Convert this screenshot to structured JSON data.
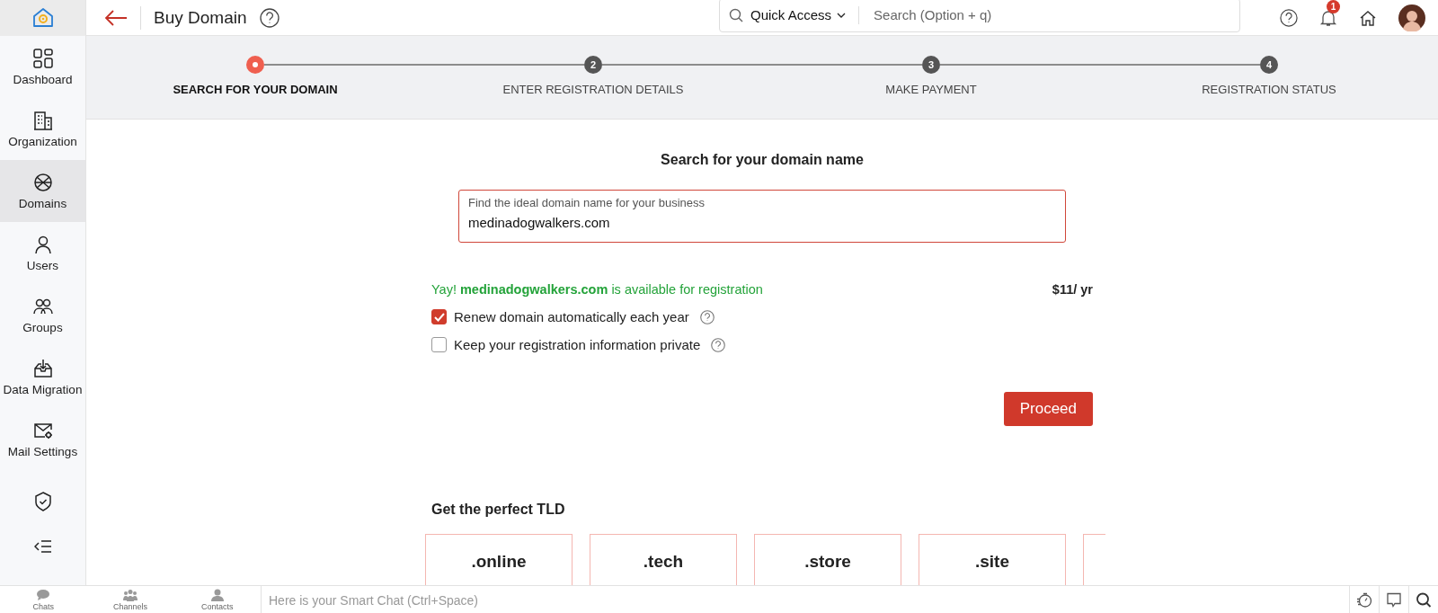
{
  "header": {
    "title": "Buy Domain",
    "quick_access": "Quick Access",
    "search": {
      "placeholder": "Search (Option + q)"
    },
    "notifications": "1"
  },
  "sidebar": {
    "items": [
      {
        "kind": "dashboard",
        "label": "Dashboard",
        "selected": false
      },
      {
        "kind": "organization",
        "label": "Organization",
        "selected": false
      },
      {
        "kind": "domains",
        "label": "Domains",
        "selected": true
      },
      {
        "kind": "users",
        "label": "Users",
        "selected": false
      },
      {
        "kind": "groups",
        "label": "Groups",
        "selected": false
      },
      {
        "kind": "migration",
        "label": "Data Migration",
        "selected": false
      },
      {
        "kind": "mail",
        "label": "Mail Settings",
        "selected": false
      },
      {
        "kind": "security",
        "selected": false
      }
    ]
  },
  "steps": [
    {
      "label": "SEARCH FOR YOUR DOMAIN",
      "selected": true
    },
    {
      "number": "2",
      "label": "ENTER REGISTRATION DETAILS",
      "selected": false
    },
    {
      "number": "3",
      "label": "MAKE PAYMENT",
      "selected": false
    },
    {
      "number": "4",
      "label": "REGISTRATION STATUS",
      "selected": false
    }
  ],
  "search_section": {
    "heading": "Search for your domain name",
    "field": {
      "label": "Find the ideal domain name for your business",
      "value": "medinadogwalkers.com"
    },
    "availability": "Yay! **medinadogwalkers.com** is available for registration",
    "price": "$11/ yr",
    "options": [
      {
        "label": "Renew domain automatically each year",
        "checked": true
      },
      {
        "label": "Keep your registration information private",
        "checked": false
      }
    ],
    "proceed": "Proceed"
  },
  "tld_section": {
    "heading": "Get the perfect TLD",
    "tlds": [
      ".online",
      ".tech",
      ".store",
      ".site"
    ],
    "partial_card": true
  },
  "bottom_bar": {
    "tabs": [
      "Chats",
      "Channels",
      "Contacts"
    ],
    "chat": {
      "placeholder": "Here is your Smart Chat (Ctrl+Space)"
    }
  }
}
